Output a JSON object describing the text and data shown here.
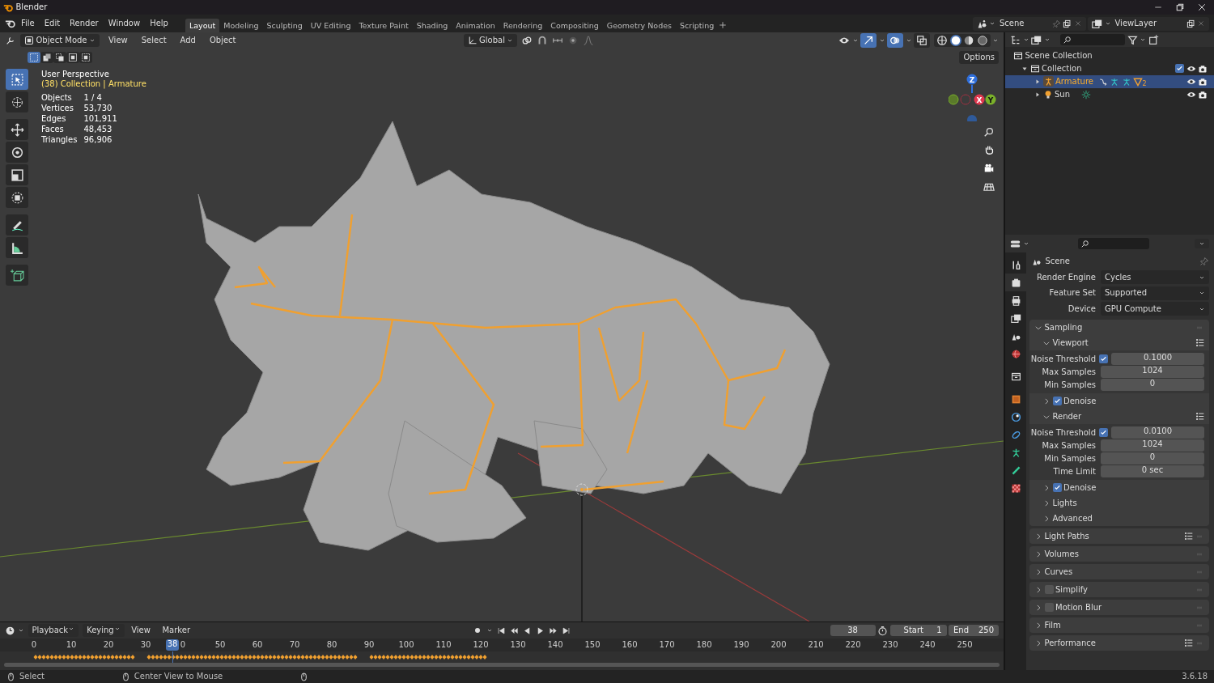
{
  "window": {
    "title": "Blender"
  },
  "menu": [
    "File",
    "Edit",
    "Render",
    "Window",
    "Help"
  ],
  "workspaces": [
    {
      "label": "Layout",
      "selected": true
    },
    {
      "label": "Modeling",
      "selected": false
    },
    {
      "label": "Sculpting",
      "selected": false
    },
    {
      "label": "UV Editing",
      "selected": false
    },
    {
      "label": "Texture Paint",
      "selected": false
    },
    {
      "label": "Shading",
      "selected": false
    },
    {
      "label": "Animation",
      "selected": false
    },
    {
      "label": "Rendering",
      "selected": false
    },
    {
      "label": "Compositing",
      "selected": false
    },
    {
      "label": "Geometry Nodes",
      "selected": false
    },
    {
      "label": "Scripting",
      "selected": false
    }
  ],
  "scene": {
    "value": "Scene"
  },
  "view_layer": {
    "value": "ViewLayer"
  },
  "viewport": {
    "mode": "Object Mode",
    "menus": [
      "View",
      "Select",
      "Add",
      "Object"
    ],
    "orientation": "Global",
    "options": "Options",
    "select_modes": [
      {
        "selected": true
      },
      {
        "selected": false
      },
      {
        "selected": false
      },
      {
        "selected": false
      },
      {
        "selected": false
      }
    ],
    "overlays": [
      {
        "kind": "gizmo",
        "on": true
      },
      {
        "kind": "overlay",
        "on": true
      },
      {
        "kind": "xray",
        "on": false
      }
    ],
    "shading": [
      {
        "kind": "wireframe",
        "selected": false
      },
      {
        "kind": "solid",
        "selected": true
      },
      {
        "kind": "material",
        "selected": false
      },
      {
        "kind": "rendered",
        "selected": false
      }
    ],
    "tools": [
      {
        "kind": "select",
        "selected": true
      },
      {
        "kind": "cursor",
        "selected": false
      },
      {
        "kind": "move",
        "selected": false
      },
      {
        "kind": "rotate",
        "selected": false
      },
      {
        "kind": "scale",
        "selected": false
      },
      {
        "kind": "transform",
        "selected": false
      },
      {
        "kind": "annotate",
        "selected": false
      },
      {
        "kind": "measure",
        "selected": false
      },
      {
        "kind": "add_cube",
        "selected": false
      }
    ],
    "info": {
      "title": "User Perspective",
      "context": "(38) Collection | Armature",
      "stats": [
        {
          "label": "Objects",
          "value": "1 / 4"
        },
        {
          "label": "Vertices",
          "value": "53,730"
        },
        {
          "label": "Edges",
          "value": "101,911"
        },
        {
          "label": "Faces",
          "value": "48,453"
        },
        {
          "label": "Triangles",
          "value": "96,906"
        }
      ]
    },
    "axes": [
      {
        "label": "Z"
      },
      {
        "label": "X"
      },
      {
        "label": "Y"
      }
    ]
  },
  "outliner": {
    "root": "Scene Collection",
    "collections": [
      {
        "label": "Collection",
        "expanded": true,
        "checked": true,
        "children": [
          {
            "kind": "armature",
            "label": "Armature",
            "selected": true,
            "expanded": false,
            "data_users": "2"
          },
          {
            "kind": "light",
            "label": "Sun",
            "selected": false,
            "expanded": false
          }
        ]
      }
    ]
  },
  "properties": {
    "tabs": [
      {
        "kind": "tool",
        "selected": false
      },
      {
        "kind": "render",
        "selected": true
      },
      {
        "kind": "output",
        "selected": false
      },
      {
        "kind": "view_layer",
        "selected": false
      },
      {
        "kind": "scene",
        "selected": false
      },
      {
        "kind": "world",
        "selected": false
      },
      {
        "kind": "collection",
        "selected": false
      },
      {
        "kind": "object",
        "selected": false
      },
      {
        "kind": "physics",
        "selected": false
      },
      {
        "kind": "constraints",
        "selected": false
      },
      {
        "kind": "data",
        "selected": false
      },
      {
        "kind": "bone",
        "selected": false
      },
      {
        "kind": "texture",
        "selected": false
      }
    ],
    "title": "Scene",
    "fields": [
      {
        "label": "Render Engine",
        "value": "Cycles"
      },
      {
        "label": "Feature Set",
        "value": "Supported"
      },
      {
        "label": "Device",
        "value": "GPU Compute"
      }
    ],
    "sections": [
      {
        "label": "Sampling",
        "expanded": true,
        "children": [
          {
            "label": "Viewport",
            "expanded": true,
            "presets": true,
            "rows": [
              {
                "label": "Noise Threshold",
                "checked": true,
                "value": "0.1000"
              },
              {
                "label": "Max Samples",
                "value": "1024"
              },
              {
                "label": "Min Samples",
                "value": "0"
              }
            ]
          },
          {
            "label": "Denoise",
            "expanded": false,
            "checked": true
          },
          {
            "label": "Render",
            "expanded": true,
            "presets": true,
            "rows": [
              {
                "label": "Noise Threshold",
                "checked": true,
                "value": "0.0100"
              },
              {
                "label": "Max Samples",
                "value": "1024"
              },
              {
                "label": "Min Samples",
                "value": "0"
              },
              {
                "label": "Time Limit",
                "value": "0 sec"
              }
            ]
          },
          {
            "label": "Denoise",
            "expanded": false,
            "checked": true
          },
          {
            "label": "Lights",
            "expanded": false
          },
          {
            "label": "Advanced",
            "expanded": false
          }
        ]
      },
      {
        "label": "Light Paths",
        "expanded": false,
        "presets": true
      },
      {
        "label": "Volumes",
        "expanded": false
      },
      {
        "label": "Curves",
        "expanded": false
      },
      {
        "label": "Simplify",
        "expanded": false,
        "checked": false
      },
      {
        "label": "Motion Blur",
        "expanded": false,
        "checked": false
      },
      {
        "label": "Film",
        "expanded": false
      },
      {
        "label": "Performance",
        "expanded": false,
        "presets": true
      }
    ]
  },
  "timeline": {
    "menus": [
      "Playback",
      "Keying",
      "View",
      "Marker"
    ],
    "frame": "38",
    "start_label": "Start",
    "start": "1",
    "end_label": "End",
    "end": "250",
    "playhead": "38",
    "ruler": [
      "0",
      "10",
      "20",
      "30",
      "0",
      "50",
      "60",
      "70",
      "80",
      "90",
      "100",
      "110",
      "120",
      "130",
      "140",
      "150",
      "160",
      "170",
      "180",
      "190",
      "200",
      "210",
      "220",
      "230",
      "240",
      "250"
    ]
  },
  "status_bar": {
    "hints": [
      "Select",
      "Center View to Mouse"
    ],
    "version": "3.6.18"
  }
}
